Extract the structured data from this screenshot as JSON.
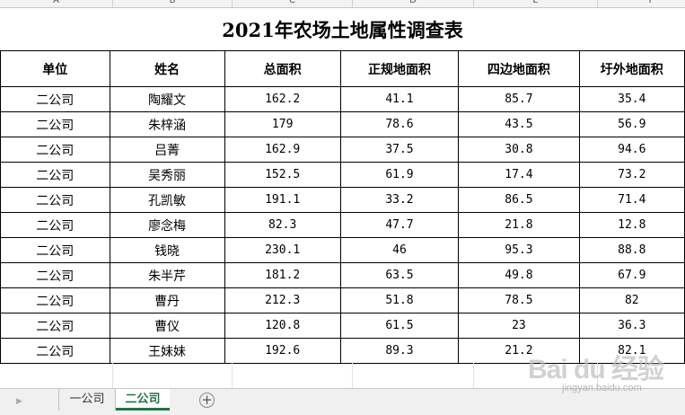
{
  "column_headers": [
    "A",
    "B",
    "C",
    "D",
    "E",
    "F"
  ],
  "sheet": {
    "title": "2021年农场土地属性调查表",
    "headers": [
      "单位",
      "姓名",
      "总面积",
      "正规地面积",
      "四边地面积",
      "圩外地面积"
    ],
    "rows": [
      [
        "二公司",
        "陶耀文",
        "162.2",
        "41.1",
        "85.7",
        "35.4"
      ],
      [
        "二公司",
        "朱梓涵",
        "179",
        "78.6",
        "43.5",
        "56.9"
      ],
      [
        "二公司",
        "吕菁",
        "162.9",
        "37.5",
        "30.8",
        "94.6"
      ],
      [
        "二公司",
        "吴秀丽",
        "152.5",
        "61.9",
        "17.4",
        "73.2"
      ],
      [
        "二公司",
        "孔凯敏",
        "191.1",
        "33.2",
        "86.5",
        "71.4"
      ],
      [
        "二公司",
        "廖念梅",
        "82.3",
        "47.7",
        "21.8",
        "12.8"
      ],
      [
        "二公司",
        "钱晓",
        "230.1",
        "46",
        "95.3",
        "88.8"
      ],
      [
        "二公司",
        "朱半芹",
        "181.2",
        "63.5",
        "49.8",
        "67.9"
      ],
      [
        "二公司",
        "曹丹",
        "212.3",
        "51.8",
        "78.5",
        "82"
      ],
      [
        "二公司",
        "曹仪",
        "120.8",
        "61.5",
        "23",
        "36.3"
      ],
      [
        "二公司",
        "王妹妹",
        "192.6",
        "89.3",
        "21.2",
        "82.1"
      ]
    ]
  },
  "tabs": [
    {
      "label": "一公司",
      "active": false
    },
    {
      "label": "二公司",
      "active": true
    }
  ],
  "add_sheet_label": "+",
  "watermark": {
    "logo": "Bai du 经验",
    "url": "jingyan.baidu.com"
  },
  "icons": {
    "prev_sheet": "triangle-right-icon",
    "add_sheet": "plus-circle-icon"
  },
  "colors": {
    "active_tab": "#217346",
    "grid_line": "#000000"
  }
}
